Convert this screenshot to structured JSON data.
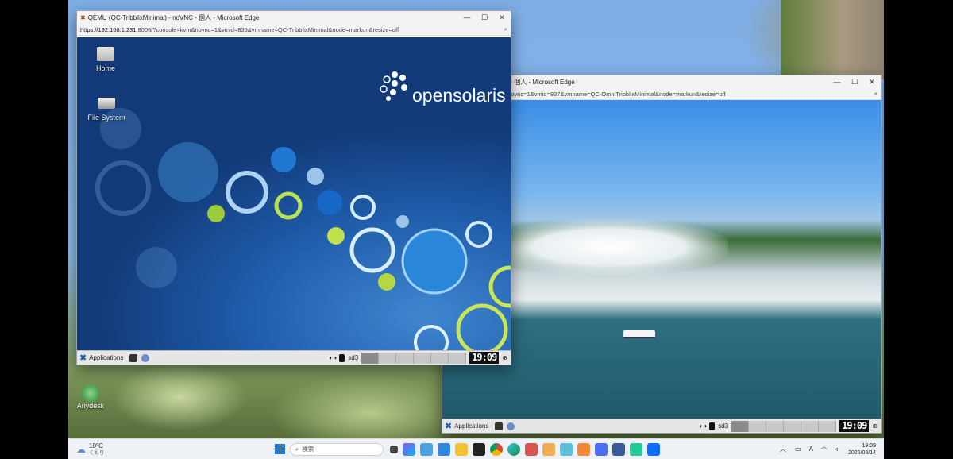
{
  "window1": {
    "title": "QEMU (QC-TribblixMinimal) - noVNC - 個人 - Microsoft Edge",
    "url_host": "https://192.168.1.231",
    "url_rest": ":8006/?console=kvm&novnc=1&vmid=835&vmname=QC-TribblixMinimal&node=markun&resize=off",
    "desktop_icons": [
      {
        "label": "Home"
      },
      {
        "label": "File System"
      }
    ],
    "logo_text": "opensolaris",
    "panel": {
      "applications_label": "Applications",
      "disk_label": "sd3",
      "clock": "19:09"
    }
  },
  "window2": {
    "title": "QEMU (QC-OmniTribblixMinimal) - noVNC - 個人 - Microsoft Edge",
    "visible_title": "iblix Minimal) - noVNC - 個人 - Microsoft Edge",
    "url_visible": "1:8006/?console=kvm&novnc=1&vmid=837&vmname=QC-OmniTribblixMinimal&node=markun&resize=off",
    "panel": {
      "applications_label": "Applications",
      "disk_label": "sd3",
      "clock": "19:09"
    }
  },
  "desktop": {
    "left_icon_label": "Anydesk"
  },
  "taskbar": {
    "weather_temp": "10°C",
    "weather_desc": "くもり",
    "search_placeholder": "検索",
    "time": "19:09",
    "date": "2026/03/14",
    "ime": "A"
  },
  "colors": {
    "accent": "#0078d4",
    "vm_bg": "#1d4f9c",
    "panel": "#e6e6e6"
  }
}
